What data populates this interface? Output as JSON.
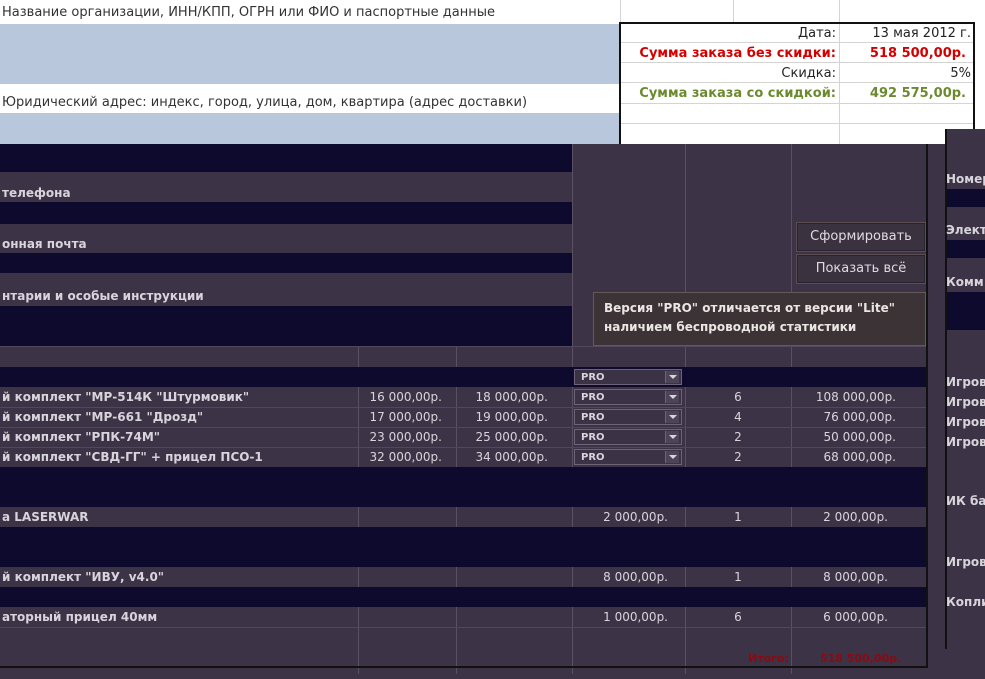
{
  "header": {
    "org_label": "Название организации, ИНН/КПП, ОГРН или ФИО и паспортные данные",
    "address_label": "Юридический адрес: индекс, город, улица, дом, квартира (адрес доставки)"
  },
  "summary": {
    "date_label": "Дата:",
    "date_value": "13 мая 2012 г.",
    "subtotal_label": "Сумма заказа без скидки:",
    "subtotal_value": "518 500,00р.",
    "discount_label": "Скидка:",
    "discount_value": "5%",
    "total_label": "Сумма заказа со скидкой:",
    "total_value": "492 575,00р.",
    "colors": {
      "red": "#d40000",
      "green": "#6b8a2e"
    }
  },
  "form_fields": {
    "phone_label": "телефона",
    "email_label": "онная почта",
    "comments_label": "нтарии и особые инструкции"
  },
  "right_panel": {
    "labels": [
      "Номер",
      "Электр",
      "Комм",
      "Игрово",
      "Игрово",
      "Игрово",
      "Игрово",
      "ИК баз",
      "Игрово",
      "Копли"
    ]
  },
  "buttons": {
    "generate": "Сформировать",
    "show_all": "Показать всё"
  },
  "tooltip": {
    "line1": "Версия \"PRO\" отличается от версии \"Lite\"",
    "line2": "наличием беспроводной статистики"
  },
  "products": [
    {
      "name": "й комплект \"МР-514К \"Штурмовик\"",
      "price_lite": "16 000,00р.",
      "price_pro": "18 000,00р.",
      "version": "PRO",
      "qty": "6",
      "sum": "108 000,00р."
    },
    {
      "name": "й комплект \"МР-661 \"Дрозд\"",
      "price_lite": "17 000,00р.",
      "price_pro": "19 000,00р.",
      "version": "PRO",
      "qty": "4",
      "sum": "76 000,00р."
    },
    {
      "name": "й комплект \"РПК-74М\"",
      "price_lite": "23 000,00р.",
      "price_pro": "25 000,00р.",
      "version": "PRO",
      "qty": "2",
      "sum": "50 000,00р."
    },
    {
      "name": "й комплект \"СВД-ГГ\" + прицел ПСО-1",
      "price_lite": "32 000,00р.",
      "price_pro": "34 000,00р.",
      "version": "PRO",
      "qty": "2",
      "sum": "68 000,00р."
    }
  ],
  "first_combo": "PRO",
  "extras": [
    {
      "name": "а LASERWAR",
      "price": "2 000,00р.",
      "qty": "1",
      "sum": "2 000,00р."
    },
    {
      "name": "й комплект \"ИВУ, v4.0\"",
      "price": "8 000,00р.",
      "qty": "1",
      "sum": "8 000,00р."
    },
    {
      "name": "аторный прицел 40мм",
      "price": "1 000,00р.",
      "qty": "6",
      "sum": "6 000,00р."
    }
  ],
  "footer": {
    "total_label": "Итого:",
    "total_value": "518 500,00р."
  }
}
